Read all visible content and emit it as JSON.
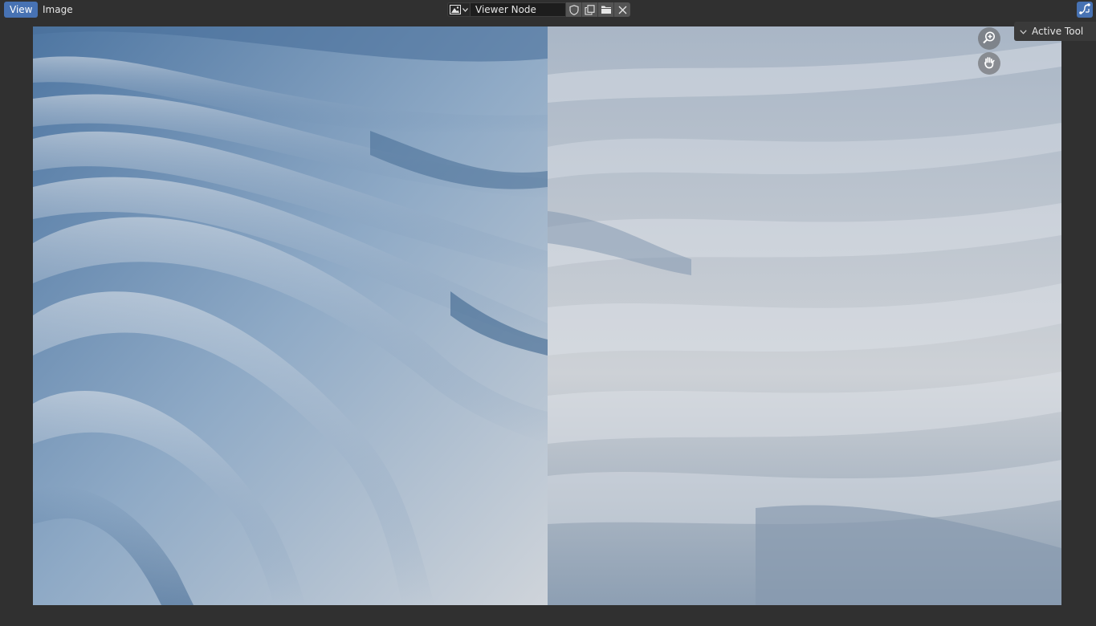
{
  "header": {
    "menus": [
      {
        "label": "View",
        "active": true
      },
      {
        "label": "Image",
        "active": false
      }
    ],
    "image_selector": {
      "browse_icon": "image-icon",
      "image_name": "Viewer Node",
      "buttons": [
        {
          "icon": "fake-user-shield-icon"
        },
        {
          "icon": "duplicate-image-icon"
        },
        {
          "icon": "open-folder-icon"
        },
        {
          "icon": "close-x-icon"
        }
      ]
    },
    "gizmo_toggle_icon": "gizmo-icon"
  },
  "sidebar": {
    "panel_label": "Active Tool",
    "collapse_icon": "chevron-down-icon"
  },
  "navigation": {
    "zoom_icon": "zoom-in-icon",
    "pan_icon": "hand-pan-icon"
  },
  "colors": {
    "accent": "#4772b3",
    "background": "#303030",
    "canvas_light": "#d2d5da",
    "canvas_dark": "#3e6590"
  }
}
